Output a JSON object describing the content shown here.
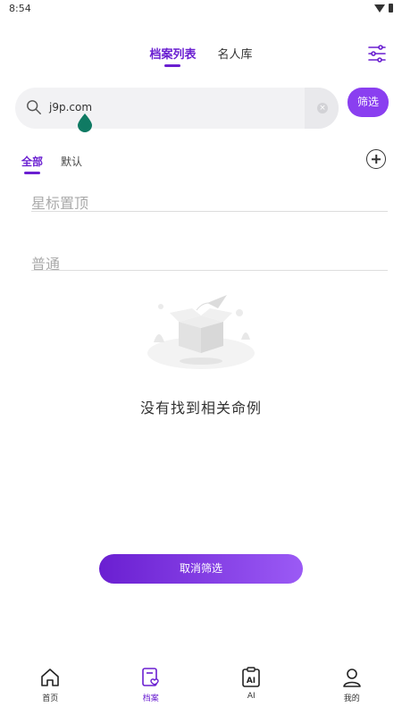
{
  "status": {
    "time": "8:54"
  },
  "header": {
    "tabs": [
      {
        "label": "档案列表",
        "active": true
      },
      {
        "label": "名人库",
        "active": false
      }
    ]
  },
  "search": {
    "value": "j9p.com",
    "filter_label": "筛选"
  },
  "subtabs": [
    {
      "label": "全部",
      "active": true
    },
    {
      "label": "默认",
      "active": false
    }
  ],
  "sections": {
    "starred": "星标置顶",
    "normal": "普通"
  },
  "empty": {
    "message": "没有找到相关命例"
  },
  "cancel_filter_label": "取消筛选",
  "nav": [
    {
      "label": "首页",
      "icon": "home-icon"
    },
    {
      "label": "档案",
      "icon": "archive-heart-icon",
      "active": true
    },
    {
      "label": "AI",
      "icon": "ai-icon"
    },
    {
      "label": "我的",
      "icon": "user-icon"
    }
  ],
  "colors": {
    "accent": "#6a1fd1",
    "accent_light": "#9b5af5"
  }
}
